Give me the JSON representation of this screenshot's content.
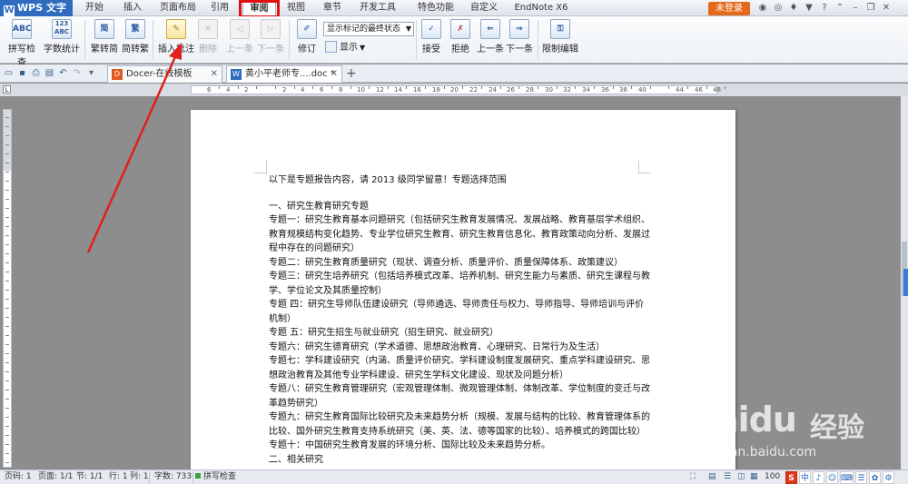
{
  "app": {
    "wps_label": "WPS 文字",
    "login_label": "未登录"
  },
  "menu": {
    "tabs": [
      "开始",
      "插入",
      "页面布局",
      "引用",
      "审阅",
      "视图",
      "章节",
      "开发工具",
      "特色功能",
      "自定义",
      "EndNote X6"
    ],
    "active_index": 4
  },
  "ribbon": {
    "spellcheck": "拼写检查",
    "wordcount": "字数统计",
    "wordcount_icon": "123\nABC",
    "spell_icon": "ABC",
    "trad_to_simp": "繁转简",
    "simp_to_trad": "简转繁",
    "trad_icon": "繁",
    "simp_icon": "简",
    "insert_comment": "插入批注",
    "delete": "删除",
    "prev": "上一条",
    "next": "下一条",
    "revise": "修订",
    "markup_select": "显示标记的最终状态",
    "show": "显示",
    "accept": "接受",
    "reject": "拒绝",
    "prev2": "上一条",
    "next2": "下一条",
    "restrict": "限制编辑"
  },
  "tabs": {
    "tab1": "Docer-在线模板",
    "tab2": "黄小平老师专....doc *"
  },
  "ruler": {
    "labels": [
      "6",
      "4",
      "2",
      "",
      "2",
      "4",
      "6",
      "8",
      "10",
      "12",
      "14",
      "16",
      "18",
      "20",
      "22",
      "24",
      "26",
      "28",
      "30",
      "32",
      "34",
      "36",
      "38",
      "40",
      "",
      "44",
      "46",
      "48"
    ]
  },
  "document": {
    "paragraphs": [
      "以下是专题报告内容，请 2013 级同学留意！专题选择范围",
      "",
      "一、研究生教育研究专题",
      "专题一：研究生教育基本问题研究（包括研究生教育发展情况、发展战略、教育基层学术组织、教育规模结构变化趋势、专业学位研究生教育、研究生教育信息化、教育政策动向分析、发展过程中存在的问题研究）",
      "专题二：研究生教育质量研究（现状、调查分析、质量评价、质量保障体系、政策建议）",
      "专题三：研究生培养研究（包括培养模式改革、培养机制、研究生能力与素质、研究生课程与教学、学位论文及其质量控制）",
      "专题 四：研究生导师队伍建设研究（导师遴选、导师责任与权力、导师指导、导师培训与评价机制）",
      "专题 五：研究生招生与就业研究（招生研究、就业研究）",
      "专题六：研究生德育研究（学术道德、思想政治教育、心理研究、日常行为及生活）",
      "专题七：学科建设研究（内涵、质量评价研究、学科建设制度发展研究、重点学科建设研究、思想政治教育及其他专业学科建设、研究生学科文化建设、现状及问题分析）",
      "专题八：研究生教育管理研究（宏观管理体制、微观管理体制、体制改革、学位制度的变迁与改革趋势研究）",
      "专题九：研究生教育国际比较研究及未来趋势分析（规模、发展与结构的比较、教育管理体系的比较、国外研究生教育支持系统研究（美、英、法、德等国家的比较）、培养模式的跨国比较）",
      "专题十：中国研究生教育发展的环境分析、国际比较及未来趋势分析。",
      "二、相关研究"
    ]
  },
  "status": {
    "page_num": "页码: 1",
    "pages": "页面: 1/1",
    "section": "节: 1/1",
    "row": "行: 1",
    "col": "列: 1",
    "words": "字数: 733",
    "spell": "拼写检查",
    "zoom": "100",
    "ime": [
      "S",
      "中",
      "♪",
      "☺",
      "⌨",
      "☰",
      "✿",
      "⚙"
    ]
  },
  "watermark": {
    "main": "Bai",
    "paw": "du",
    "cn": "经验",
    "sub": "jingyan.baidu.com"
  },
  "colors": {
    "accent": "#2f6cbf",
    "highlight": "#e01010",
    "login": "#e5691a"
  }
}
